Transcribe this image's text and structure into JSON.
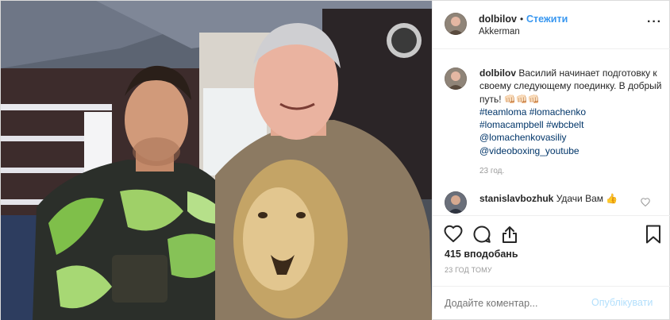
{
  "post": {
    "photo": {
      "subject": "photo-two-men-boxing-gym"
    },
    "header": {
      "username": "dolbilov",
      "dot": "•",
      "follow_label": "Стежити",
      "location": "Akkerman",
      "more_icon": "more-horizontal-icon"
    },
    "caption": {
      "username": "dolbilov",
      "text": "Василий начинает подготовку к своему следующему поединку. В добрый путь! 👊🏻👊🏻👊🏻",
      "tags": [
        "#teamloma #lomachenko",
        "#lomacampbell #wbcbelt",
        "@lomachenkovasiliy",
        "@videoboxing_youtube"
      ],
      "time": "23 год."
    },
    "comment": {
      "username": "stanislavbozhuk",
      "text": "Удачи Вам 👍"
    },
    "actions": {
      "like_icon": "heart-icon",
      "comment_icon": "comment-icon",
      "share_icon": "share-icon",
      "save_icon": "bookmark-icon",
      "likes": "415 вподобань",
      "ago": "23 ГОД ТОМУ"
    },
    "add_comment": {
      "placeholder": "Додайте коментар...",
      "post_label": "Опублікувати"
    },
    "colors": {
      "link": "#003569",
      "accent": "#3897f0",
      "post_disabled": "#b2dffc"
    }
  }
}
